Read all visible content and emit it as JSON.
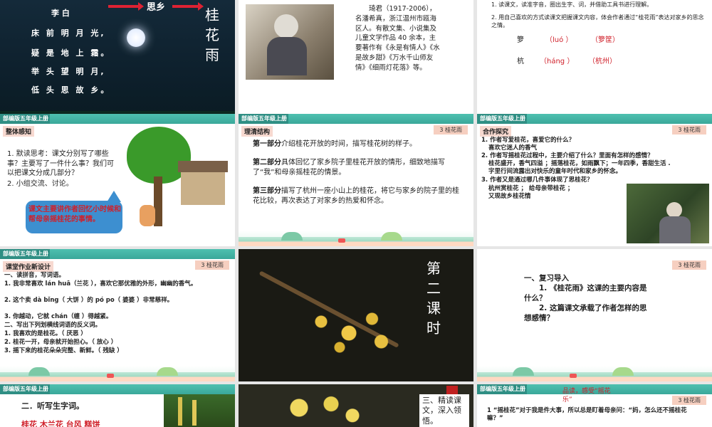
{
  "slides": {
    "s1": {
      "poet": "李 白",
      "lines": [
        "床 前 明 月 光,",
        "疑 是 地 上 霜。",
        "举 头 望 明 月,",
        "低 头 思 故 乡。"
      ],
      "arrow_word": "思乡",
      "vertical_title": [
        "桂",
        "花",
        "雨"
      ]
    },
    "s2": {
      "bio": "琦君（1917-2006），名潘希真，浙江温州市瓯海区人。有散文集、小说集及儿童文学作品 40 余本，主要著作有《永是有情人》《水是故乡甜》《万水千山师友情》《细雨灯花落》等。"
    },
    "s3": {
      "item1": "1. 读课文，读准字音，圈出生字、词，并借助工具书进行理解。",
      "item2": "2. 用自己喜欢的方式读课文把握课文内容，体会作者通过“桂花雨”表达对家乡的思念之情。",
      "row1": {
        "char": "箩",
        "pinyin": "（luó ）",
        "word": "（箩筐）"
      },
      "row2": {
        "char": "杭",
        "pinyin": "（háng ）",
        "word": "（杭州）"
      }
    },
    "s4": {
      "grade": "部编版五年级上册",
      "label": "整体感知",
      "q1": "1. 默读思考：课文分别写了哪些事？主要写了一件什么事？我们可以把课文分成几部分？",
      "q2": "2. 小组交流、讨论。",
      "bubble": "课文主要讲作者回忆小时候和帮母亲摇桂花的事情。"
    },
    "s5": {
      "grade": "部编版五年级上册",
      "label": "理清结构",
      "tag": "3 桂花雨",
      "p1_head": "第一部分",
      "p1": "介绍桂花开放的时间，描写桂花树的样子。",
      "p2_head": "第二部分",
      "p2": "具体回忆了家乡院子里桂花开放的情形，细致地描写了“我”和母亲摇桂花的情景。",
      "p3_head": "第三部分",
      "p3": "描写了杭州一座小山上的桂花，将它与家乡的院子里的桂花比较，再次表达了对家乡的热爱和怀念。"
    },
    "s6": {
      "grade": "部编版五年级上册",
      "label": "合作探究",
      "tag": "3 桂花雨",
      "q1": "1. 作者写爱桂花，喜爱它的什么？",
      "a1": "喜欢它迷人的香气",
      "q2": "2. 作者写摇桂花过程中，主要介绍了什么？里面有怎样的感情？",
      "a2a": "桂花盛开，香气四溢 ；摇落桂花，如雨飘下；一年四季，香甜生活 .",
      "a2b": "字里行间流露出对快乐的童年时代和家乡的怀念。",
      "q3": "3. 作者又是通过哪几件事体现了思桂花？",
      "a3a": "杭州赏桂花 ； 给母亲带桂花 ；",
      "a3b": "又现故乡桂花情"
    },
    "s7": {
      "grade": "部编版五年级上册",
      "label": "课堂作业新设计",
      "tag": "3 桂花雨",
      "h1": "一、读拼音，写词语。",
      "l1": "1. 我非常喜欢 lán huā（兰花 ），喜欢它那优雅的外形，幽幽的香气。",
      "l2": "2. 这个卖 dà bǐng（ 大饼 ）的 pó po（ 婆婆 ）非常慈祥。",
      "l3": "3. 你越动，它就 chán（缠 ）得越紧。",
      "h2": "二、写出下列划横线词语的反义词。",
      "m1": "1. 我喜欢的是桂花。（ 厌恶 ）",
      "m2": "2. 桂花一开，母亲就开始担心。（ 放心 ）",
      "m3": "3. 摇下来的桂花朵朵完整、新鲜。（ 残缺 ）"
    },
    "s8": {
      "vertical": [
        "第",
        "二",
        "课",
        "时"
      ]
    },
    "s9": {
      "tag": "3 桂花雨",
      "h": "一、复习导入",
      "q1": "1. 《桂花雨》这课的主要内容是什么？",
      "q2": "2. 这篇课文承载了作者怎样的思想感情？"
    },
    "s10": {
      "grade": "部编版五年级上册",
      "h": "二．听写生字词。",
      "words": "桂花  木兰花  台风  糕饼"
    },
    "s11": {
      "text": "三、精读课文，深入领悟。"
    },
    "s12": {
      "grade": "部编版五年级上册",
      "tag": "3 桂花雨",
      "title": "品读，感受“摇花乐”",
      "l1": "1 “摇桂花”对于我是件大事，所以总是盯着母亲问：“妈，怎么还不摇桂花嘛？”"
    }
  }
}
